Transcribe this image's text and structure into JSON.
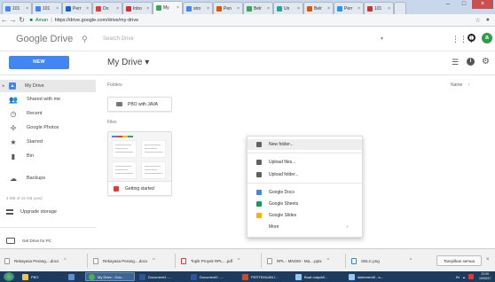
{
  "browser": {
    "tabs": [
      {
        "label": "101"
      },
      {
        "label": "101"
      },
      {
        "label": "Perr"
      },
      {
        "label": "Do"
      },
      {
        "label": "Inbo"
      },
      {
        "label": "My"
      },
      {
        "label": "stro"
      },
      {
        "label": "Pen"
      },
      {
        "label": "Belr"
      },
      {
        "label": "Un"
      },
      {
        "label": "Belr"
      },
      {
        "label": "Perr"
      },
      {
        "label": "101"
      }
    ],
    "secure_label": "Aman",
    "url": "https://drive.google.com/drive/my-drive"
  },
  "header": {
    "logo_text": "Google Drive",
    "search_placeholder": "Search Drive",
    "avatar_letter": "a"
  },
  "toolbar": {
    "new_label": "NEW",
    "page_title": "My Drive ▾"
  },
  "sidebar": {
    "items": [
      {
        "label": "My Drive"
      },
      {
        "label": "Shared with me"
      },
      {
        "label": "Recent"
      },
      {
        "label": "Google Photos"
      },
      {
        "label": "Starred"
      },
      {
        "label": "Bin"
      },
      {
        "label": "Backups"
      }
    ],
    "storage_text": "4 MB of 15 GB used",
    "upgrade_label": "Upgrade storage",
    "get_drive_label": "Get Drive for PC"
  },
  "main": {
    "folders_label": "Folders",
    "files_label": "Files",
    "sort_label": "Name",
    "folder_name": "PBO with JAVA",
    "file_name": "Getting started"
  },
  "context_menu": {
    "items": [
      {
        "label": "New folder...",
        "color": "#616161"
      },
      {
        "label": "Upload files...",
        "color": "#616161"
      },
      {
        "label": "Upload folder...",
        "color": "#616161"
      },
      {
        "label": "Google Docs",
        "color": "#4285f4"
      },
      {
        "label": "Google Sheets",
        "color": "#0f9d58"
      },
      {
        "label": "Google Slides",
        "color": "#f4b400"
      },
      {
        "label": "More",
        "color": "#ffffff"
      }
    ]
  },
  "downloads": {
    "items": [
      {
        "label": "Rekayasa Perang....docx"
      },
      {
        "label": "Rekayasa Perang....docx"
      },
      {
        "label": "Topik Proyek RPL....pdf"
      },
      {
        "label": "RPL - MNOM - Ma....pptx"
      },
      {
        "label": "SDLC.png"
      }
    ],
    "show_all_label": "Tampilkan semua"
  },
  "taskbar": {
    "items": [
      {
        "label": "PBO"
      },
      {
        "label": ""
      },
      {
        "label": "My Drive - Goo..."
      },
      {
        "label": "Document1 - ..."
      },
      {
        "label": "Document2 - ..."
      },
      {
        "label": "PERTEMUAN I..."
      },
      {
        "label": "Buat output8..."
      },
      {
        "label": "statement8 - a..."
      }
    ],
    "tray_lang": "IN",
    "time": "22:00",
    "date": "19/03/17"
  },
  "colors": {
    "accent": "#4285f4",
    "drive_green": "#34a853",
    "avatar_bg": "#2d9b4a",
    "taskbar_bg": "#1d3a5f"
  }
}
